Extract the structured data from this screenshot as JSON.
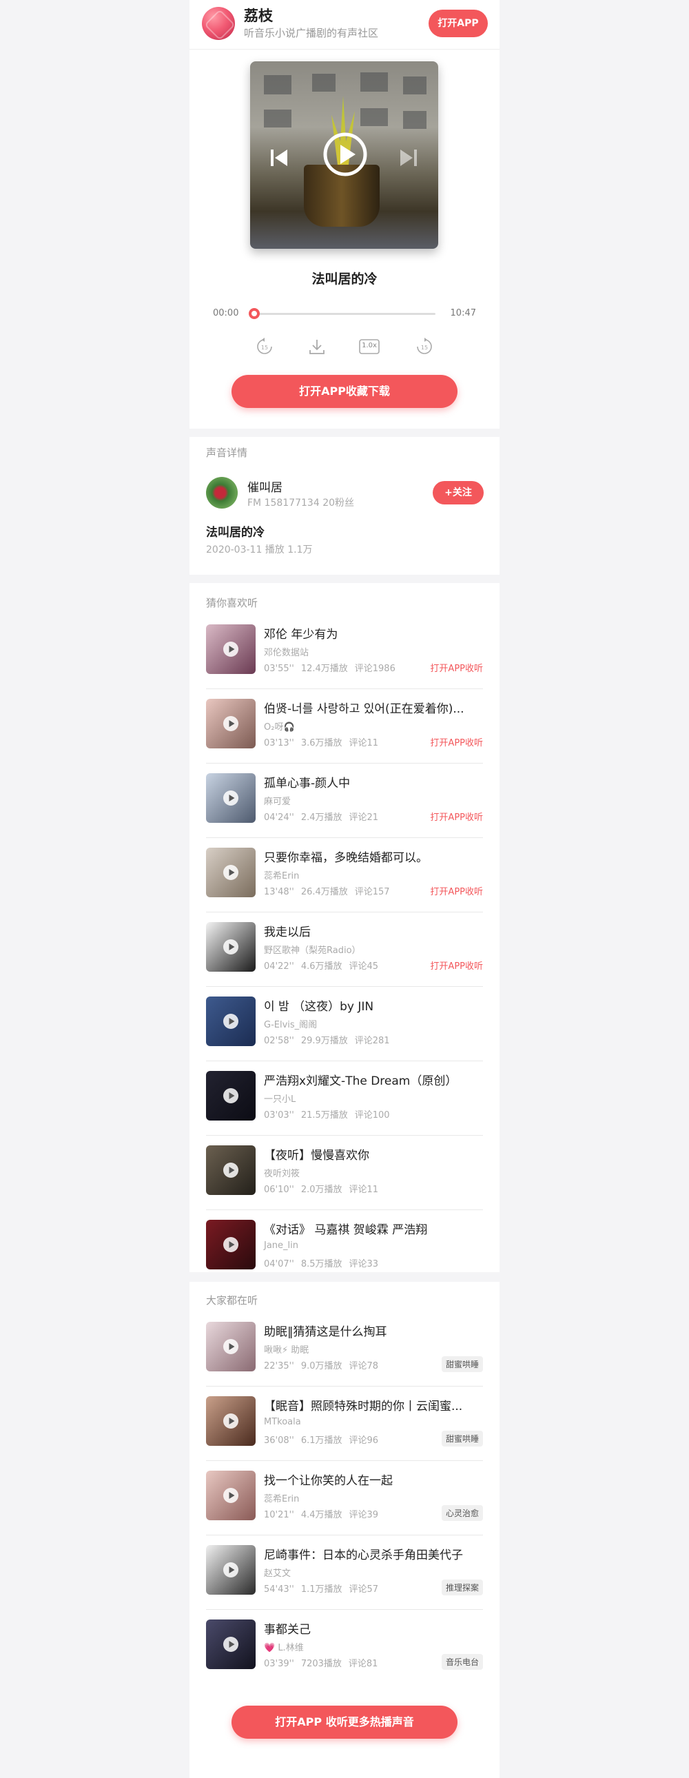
{
  "header": {
    "app_name": "荔枝",
    "app_desc": "听音乐小说广播剧的有声社区",
    "open_app": "打开APP"
  },
  "player": {
    "title": "法叫居的冷",
    "time_start": "00:00",
    "time_end": "10:47",
    "progress": 0,
    "speed": "1.0x",
    "collect_button": "打开APP收藏下载"
  },
  "details": {
    "section_title": "声音详情",
    "author_name": "催叫居",
    "author_meta": "FM 158177134 20粉丝",
    "follow_button": "+关注",
    "title": "法叫居的冷",
    "meta": "2020-03-11 播放 1.1万"
  },
  "recommend": {
    "section_title": "猜你喜欢听",
    "items": [
      {
        "title": "邓伦 年少有为",
        "author": "邓伦数据站",
        "duration": "03'55''",
        "plays": "12.4万播放",
        "comments": "评论1986",
        "action": "打开APP收听",
        "c1": "#d9b9c5",
        "c2": "#6a3a52"
      },
      {
        "title": "伯贤-너를 사랑하고 있어(正在爱着你)...",
        "author": "O₂呀🎧",
        "duration": "03'13''",
        "plays": "3.6万播放",
        "comments": "评论11",
        "action": "打开APP收听",
        "c1": "#e9c7c0",
        "c2": "#7c5a52"
      },
      {
        "title": "孤单心事-颜人中",
        "author": "麻可爱",
        "duration": "04'24''",
        "plays": "2.4万播放",
        "comments": "评论21",
        "action": "打开APP收听",
        "c1": "#c8d3e2",
        "c2": "#4e5a6e"
      },
      {
        "title": "只要你幸福，多晚结婚都可以。",
        "author": "蕊希Erin",
        "duration": "13'48''",
        "plays": "26.4万播放",
        "comments": "评论157",
        "action": "打开APP收听",
        "c1": "#d8cfc6",
        "c2": "#7a6c5c"
      },
      {
        "title": "我走以后",
        "author": "野区歌神（梨苑Radio）",
        "duration": "04'22''",
        "plays": "4.6万播放",
        "comments": "评论45",
        "action": "打开APP收听",
        "c1": "#f3f3f3",
        "c2": "#1a1a1a"
      },
      {
        "title": "이 밤 （这夜）by JIN",
        "author": "G-Elvis_阁阁",
        "duration": "02'58''",
        "plays": "29.9万播放",
        "comments": "评论281",
        "action": "",
        "c1": "#3e5a8e",
        "c2": "#1b2c52"
      },
      {
        "title": "严浩翔x刘耀文-The Dream（原创）",
        "author": "一只小L",
        "duration": "03'03''",
        "plays": "21.5万播放",
        "comments": "评论100",
        "action": "",
        "c1": "#222230",
        "c2": "#0c0c14"
      },
      {
        "title": "【夜听】慢慢喜欢你",
        "author": "夜听刘筱",
        "duration": "06'10''",
        "plays": "2.0万播放",
        "comments": "评论11",
        "action": "",
        "c1": "#6b6050",
        "c2": "#23201a"
      },
      {
        "title": "《对话》 马嘉祺 贺峻霖 严浩翔",
        "author": "Jane_lin",
        "duration": "04'07''",
        "plays": "8.5万播放",
        "comments": "评论33",
        "action": "",
        "c1": "#7a1a22",
        "c2": "#2a0a0d"
      }
    ]
  },
  "popular": {
    "section_title": "大家都在听",
    "items": [
      {
        "title": "助眠‖猜猜这是什么掏耳",
        "author": "啾啾⚡ 助眠",
        "duration": "22'35''",
        "plays": "9.0万播放",
        "comments": "评论78",
        "tag": "甜蜜哄睡",
        "c1": "#e8d8dc",
        "c2": "#8a6a72"
      },
      {
        "title": "【眠音】照顾特殊时期的你丨云闺蜜...",
        "author": "MTkoala",
        "duration": "36'08''",
        "plays": "6.1万播放",
        "comments": "评论96",
        "tag": "甜蜜哄睡",
        "c1": "#c9a08a",
        "c2": "#4a2a1e"
      },
      {
        "title": "找一个让你笑的人在一起",
        "author": "蕊希Erin",
        "duration": "10'21''",
        "plays": "4.4万播放",
        "comments": "评论39",
        "tag": "心灵治愈",
        "c1": "#e8c8c2",
        "c2": "#8a5a56"
      },
      {
        "title": "尼崎事件：日本的心灵杀手角田美代子",
        "author": "赵艾文",
        "duration": "54'43''",
        "plays": "1.1万播放",
        "comments": "评论57",
        "tag": "推理探案",
        "c1": "#f0f0f0",
        "c2": "#2a2a2a"
      },
      {
        "title": "事都关己",
        "author": "💗 L.林维",
        "duration": "03'39''",
        "plays": "7203播放",
        "comments": "评论81",
        "tag": "音乐电台",
        "c1": "#4a4a6a",
        "c2": "#12121e"
      }
    ],
    "more_button": "打开APP 收听更多热播声音"
  },
  "colors": {
    "accent": "#f3575b",
    "background": "#f4f4f6",
    "muted": "#999999"
  },
  "icons": [
    "logo",
    "prev-icon",
    "play-icon",
    "next-icon",
    "rewind-15-icon",
    "download-icon",
    "speed-icon",
    "forward-15-icon",
    "play-overlay-icon"
  ]
}
